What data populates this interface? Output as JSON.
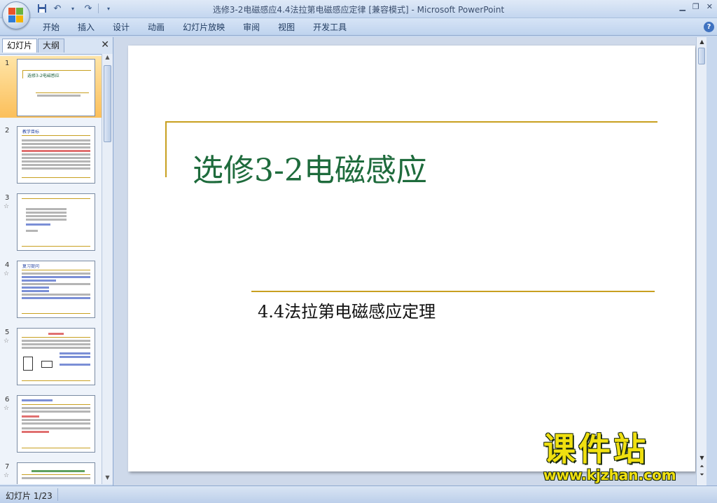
{
  "window": {
    "title": "选修3-2电磁感应4.4法拉第电磁感应定律 [兼容模式] - Microsoft PowerPoint"
  },
  "ribbon": {
    "tabs": [
      "开始",
      "插入",
      "设计",
      "动画",
      "幻灯片放映",
      "审阅",
      "视图",
      "开发工具"
    ]
  },
  "left_pane": {
    "tab_slides": "幻灯片",
    "tab_outline": "大纲",
    "thumbnails": [
      {
        "num": "1",
        "star": "",
        "title": "选修3-2电磁感应"
      },
      {
        "num": "2",
        "star": "☆",
        "title": "教学目标"
      },
      {
        "num": "3",
        "star": "☆",
        "title": ""
      },
      {
        "num": "4",
        "star": "☆",
        "title": "复习提问"
      },
      {
        "num": "5",
        "star": "☆",
        "title": ""
      },
      {
        "num": "6",
        "star": "☆",
        "title": ""
      },
      {
        "num": "7",
        "star": "☆",
        "title": ""
      }
    ]
  },
  "slide": {
    "title": "选修3-2电磁感应",
    "subtitle": "4.4法拉第电磁感应定理"
  },
  "watermark": {
    "top": "课件站",
    "bottom": "www.kjzhan.com"
  },
  "status": {
    "slide_indicator": "幻灯片 1/23"
  }
}
